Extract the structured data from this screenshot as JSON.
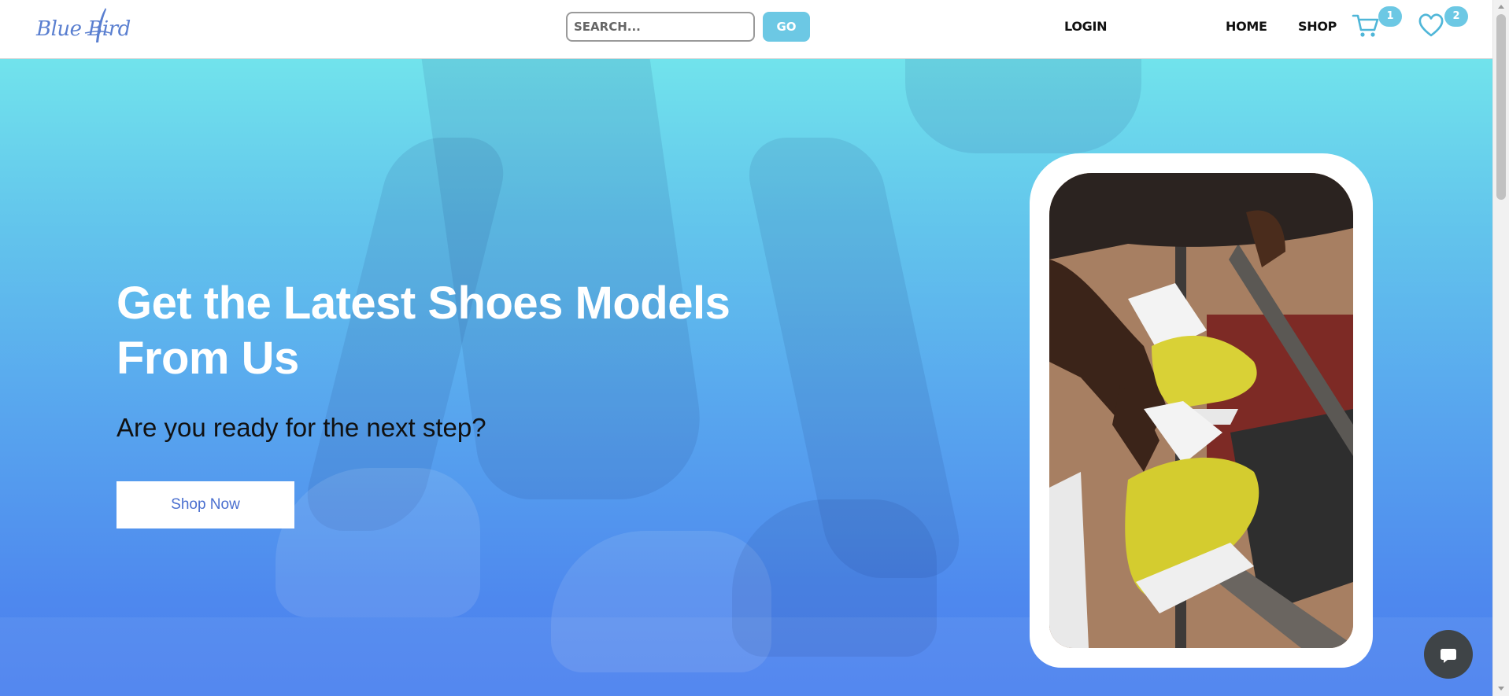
{
  "header": {
    "logo_text": "Blue Bird",
    "search": {
      "placeholder": "SEARCH...",
      "value": ""
    },
    "go_label": "GO",
    "nav": {
      "login": "LOGIN",
      "home": "HOME",
      "shop": "SHOP"
    },
    "cart": {
      "icon": "cart-icon",
      "count": "1"
    },
    "wishlist": {
      "icon": "heart-icon",
      "count": "2"
    }
  },
  "hero": {
    "title": "Get the Latest Shoes Models From Us",
    "subtitle": "Are you ready for the next step?",
    "cta_label": "Shop Now"
  },
  "chat": {
    "icon": "chat-bubble-icon"
  },
  "colors": {
    "accent": "#6cc8e4",
    "hero_top": "#71e3ec",
    "hero_bottom": "#4a80ee",
    "cta_text": "#4a6fcf",
    "chat_button": "#3f4447"
  }
}
